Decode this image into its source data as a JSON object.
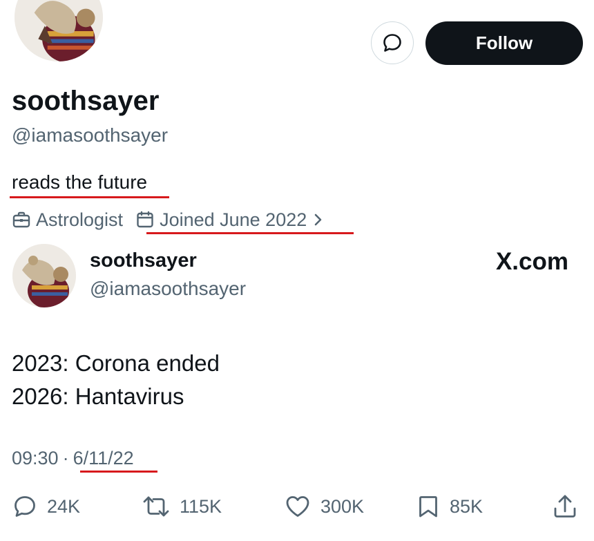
{
  "profile": {
    "display_name": "soothsayer",
    "handle": "@iamasoothsayer",
    "bio": "reads the future",
    "profession": "Astrologist",
    "joined": "Joined June 2022",
    "follow_label": "Follow"
  },
  "tweet": {
    "display_name": "soothsayer",
    "handle": "@iamasoothsayer",
    "source_label": "X.com",
    "lines": [
      "2023: Corona ended",
      "2026: Hantavirus"
    ],
    "time": "09:30",
    "separator": "·",
    "date": "6/11/22",
    "stats": {
      "replies": "24K",
      "reposts": "115K",
      "likes": "300K",
      "bookmarks": "85K"
    }
  },
  "colors": {
    "text": "#0f1419",
    "secondary": "#536471",
    "follow_bg": "#0f1419",
    "underline_annotation": "#d7191c"
  },
  "icons": [
    "message-icon",
    "briefcase-icon",
    "calendar-icon",
    "chevron-right-icon",
    "reply-icon",
    "repost-icon",
    "like-icon",
    "bookmark-icon",
    "share-icon"
  ]
}
